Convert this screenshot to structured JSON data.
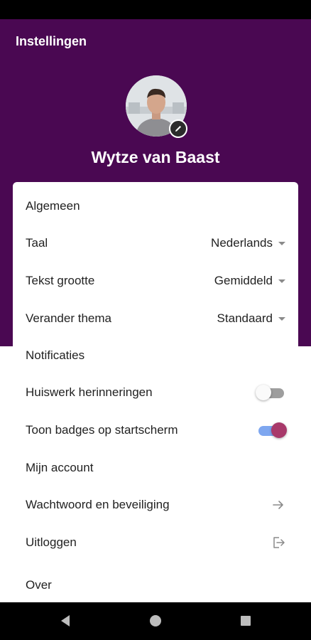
{
  "app": {
    "title": "Instellingen"
  },
  "profile": {
    "name": "Wytze van Baast"
  },
  "sections": {
    "general": "Algemeen",
    "notifications": "Notificaties",
    "account": "Mijn account",
    "about": "Over"
  },
  "general": {
    "language": {
      "label": "Taal",
      "value": "Nederlands"
    },
    "text_size": {
      "label": "Tekst grootte",
      "value": "Gemiddeld"
    },
    "theme": {
      "label": "Verander thema",
      "value": "Standaard"
    }
  },
  "notifications": {
    "homework": {
      "label": "Huiswerk herinneringen",
      "enabled": false
    },
    "badges": {
      "label": "Toon badges op startscherm",
      "enabled": true
    }
  },
  "account": {
    "password": {
      "label": "Wachtwoord en beveiliging",
      "icon": "arrow-right-icon"
    },
    "logout": {
      "label": "Uitloggen",
      "icon": "logout-icon"
    }
  },
  "colors": {
    "header": "#4a0852",
    "toggle_on_thumb": "#a8396a",
    "toggle_on_track": "#7ea7f0"
  }
}
